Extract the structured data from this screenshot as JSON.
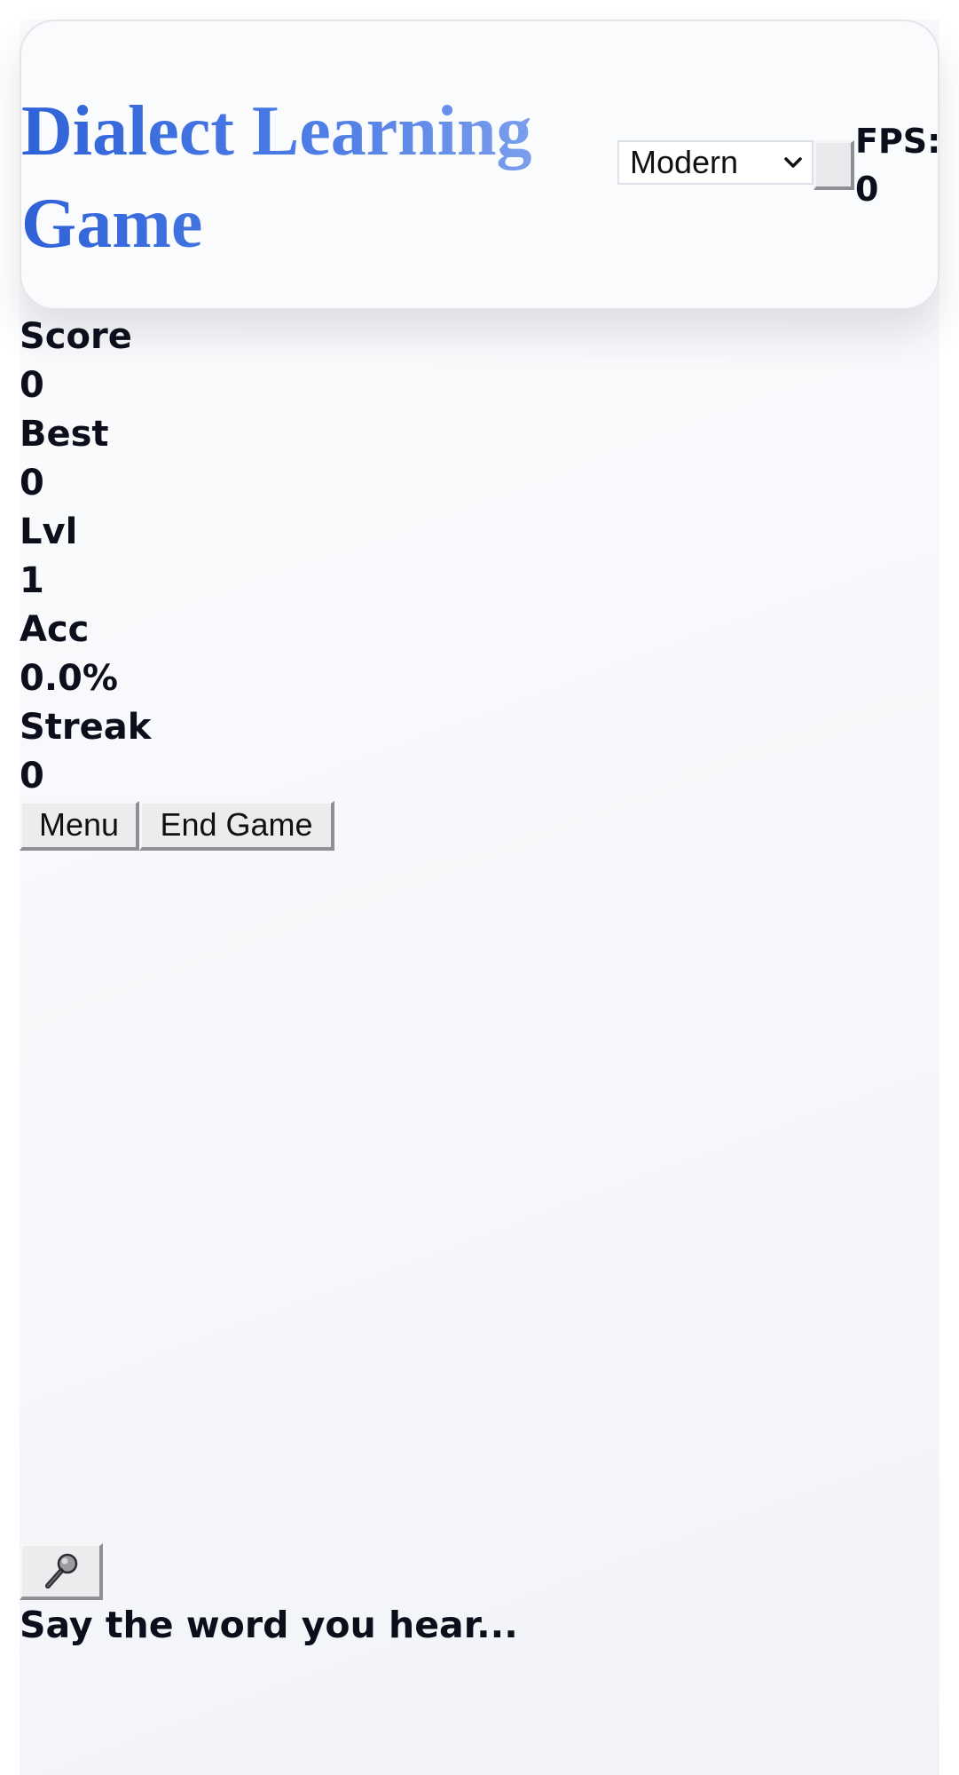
{
  "header": {
    "title": "Dialect Learning Game",
    "mode_select": {
      "selected": "Modern"
    },
    "fps_label": "FPS:",
    "fps_value": "0"
  },
  "stats": [
    {
      "label": "Score",
      "value": "0"
    },
    {
      "label": "Best",
      "value": "0"
    },
    {
      "label": "Lvl",
      "value": "1"
    },
    {
      "label": "Acc",
      "value": "0.0%"
    },
    {
      "label": "Streak",
      "value": "0"
    }
  ],
  "controls": {
    "menu_label": "Menu",
    "end_game_label": "End Game"
  },
  "mic": {
    "icon": "microphone-icon"
  },
  "prompt": "Say the word you hear...",
  "colors": {
    "title_gradient_start": "#2f62d8",
    "title_gradient_end": "#87a6ee",
    "text": "#0d0e1c",
    "background": "#f7f8fb"
  }
}
